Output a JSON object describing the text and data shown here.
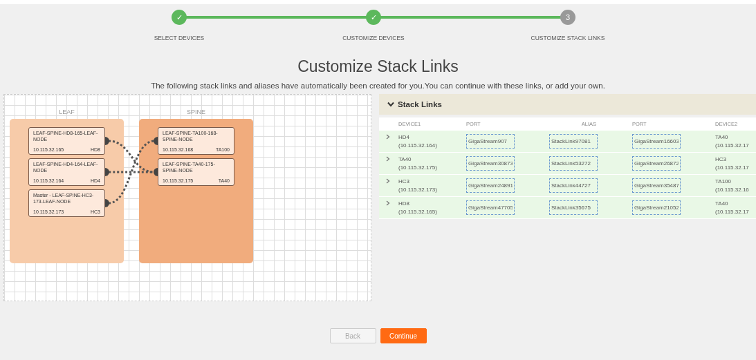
{
  "steps": [
    {
      "label": "SELECT DEVICES",
      "marker": "✓",
      "completed": true
    },
    {
      "label": "CUSTOMIZE DEVICES",
      "marker": "✓",
      "completed": true
    },
    {
      "label": "CUSTOMIZE STACK LINKS",
      "marker": "3",
      "completed": false
    }
  ],
  "title": "Customize Stack Links",
  "subtitle": "The following stack links and aliases have automatically been created for you.You can continue with these links, or add your own.",
  "diagram": {
    "groups": [
      {
        "label": "LEAF",
        "kind": "leaf",
        "nodes": [
          {
            "name": "LEAF-SPINE-HD8-165-LEAF-NODE",
            "ip": "10.115.32.165",
            "alias": "HD8"
          },
          {
            "name": "LEAF-SPINE-HD4-164-LEAF-NODE",
            "ip": "10.115.32.164",
            "alias": "HD4"
          },
          {
            "name": "Master - LEAF-SPINE-HC3-173-LEAF-NODE",
            "ip": "10.115.32.173",
            "alias": "HC3"
          }
        ]
      },
      {
        "label": "SPINE",
        "kind": "spine",
        "nodes": [
          {
            "name": "LEAF-SPINE-TA100-168-SPINE-NODE",
            "ip": "10.115.32.168",
            "alias": "TA100"
          },
          {
            "name": "LEAF-SPINE-TA40-175-SPINE-NODE",
            "ip": "10.115.32.175",
            "alias": "TA40"
          }
        ]
      }
    ]
  },
  "stack_links": {
    "title": "Stack Links",
    "expanded": true,
    "columns": [
      "DEVICE1",
      "PORT",
      "ALIAS",
      "PORT",
      "DEVICE2"
    ],
    "rows": [
      {
        "expanded": false,
        "device1": "HD4",
        "device1_ip": "(10.115.32.164)",
        "port1": "GigaStream907",
        "alias": "StackLink97081",
        "port2": "GigaStream16603",
        "device2": "TA40",
        "device2_ip": "(10.115.32.17"
      },
      {
        "expanded": false,
        "device1": "TA40",
        "device1_ip": "(10.115.32.175)",
        "port1": "GigaStream30873",
        "alias": "StackLink53272",
        "port2": "GigaStream26872",
        "device2": "HC3",
        "device2_ip": "(10.115.32.17"
      },
      {
        "expanded": false,
        "device1": "HC3",
        "device1_ip": "(10.115.32.173)",
        "port1": "GigaStream24891",
        "alias": "StackLink44727",
        "port2": "GigaStream35487",
        "device2": "TA100",
        "device2_ip": "(10.115.32.16"
      },
      {
        "expanded": false,
        "device1": "HD8",
        "device1_ip": "(10.115.32.165)",
        "port1": "GigaStream47705",
        "alias": "StackLink35675",
        "port2": "GigaStream21052",
        "device2": "TA40",
        "device2_ip": "(10.115.32.17"
      }
    ]
  },
  "buttons": [
    {
      "label": "Back",
      "kind": "secondary",
      "disabled": true
    },
    {
      "label": "Continue",
      "kind": "primary",
      "disabled": false
    }
  ]
}
